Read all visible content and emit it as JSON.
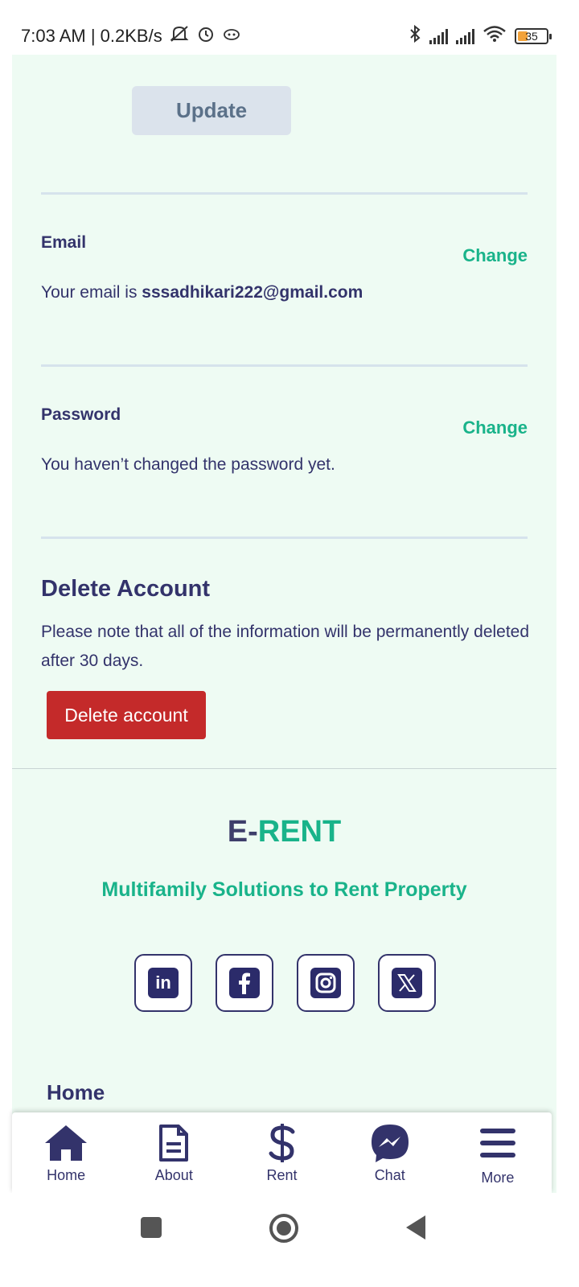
{
  "status_bar": {
    "time_speed": "7:03 AM | 0.2KB/s",
    "battery": "35"
  },
  "profile": {
    "update_label": "Update",
    "email": {
      "label": "Email",
      "change_label": "Change",
      "text_prefix": "Your email is ",
      "address": "sssadhikari222@gmail.com"
    },
    "password": {
      "label": "Password",
      "change_label": "Change",
      "text": "You haven’t changed the password yet."
    },
    "delete": {
      "title": "Delete Account",
      "note": "Please note that all of the information will be permanently deleted after 30 days.",
      "button_label": "Delete account"
    }
  },
  "footer": {
    "brand_part1": "E-",
    "brand_part2": "RENT",
    "tagline": "Multifamily Solutions to Rent Property",
    "socials": [
      "linkedin-icon",
      "facebook-icon",
      "instagram-icon",
      "x-icon"
    ],
    "home_link": "Home"
  },
  "bottom_nav": {
    "items": [
      {
        "label": "Home",
        "icon": "home-icon"
      },
      {
        "label": "About",
        "icon": "document-icon"
      },
      {
        "label": "Rent",
        "icon": "dollar-icon"
      },
      {
        "label": "Chat",
        "icon": "messenger-icon"
      },
      {
        "label": "More",
        "icon": "menu-icon"
      }
    ]
  },
  "colors": {
    "brand_dark": "#33336b",
    "brand_green": "#19b38a",
    "danger": "#c42a2a",
    "page_bg": "#eefbf3"
  }
}
